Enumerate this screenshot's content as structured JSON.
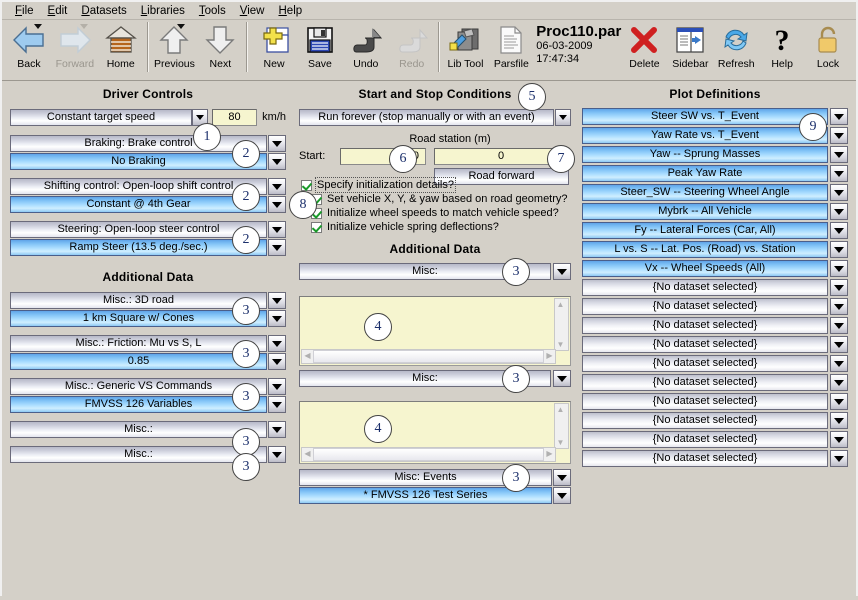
{
  "menu": {
    "items": [
      "File",
      "Edit",
      "Datasets",
      "Libraries",
      "Tools",
      "View",
      "Help"
    ]
  },
  "toolbar": {
    "buttons": [
      {
        "label": "Back",
        "icon": "back-arrow-icon",
        "enabled": true,
        "dropdown": true
      },
      {
        "label": "Forward",
        "icon": "forward-arrow-icon",
        "enabled": false,
        "dropdown": true
      },
      {
        "label": "Home",
        "icon": "home-icon",
        "enabled": true,
        "dropdown": false
      },
      {
        "label": "Previous",
        "icon": "up-arrow-icon",
        "enabled": true,
        "dropdown": true
      },
      {
        "label": "Next",
        "icon": "down-arrow-icon",
        "enabled": true,
        "dropdown": false
      },
      {
        "label": "New",
        "icon": "new-document-icon",
        "enabled": true,
        "dropdown": false
      },
      {
        "label": "Save",
        "icon": "floppy-disk-icon",
        "enabled": true,
        "dropdown": false
      },
      {
        "label": "Undo",
        "icon": "undo-arrow-icon",
        "enabled": true,
        "dropdown": false
      },
      {
        "label": "Redo",
        "icon": "redo-arrow-icon",
        "enabled": false,
        "dropdown": false
      },
      {
        "label": "Lib Tool",
        "icon": "library-tool-icon",
        "enabled": true,
        "dropdown": false
      },
      {
        "label": "Parsfile",
        "icon": "parsfile-icon",
        "enabled": true,
        "dropdown": false
      }
    ],
    "file_name": "Proc110.par",
    "file_date": "06-03-2009 17:47:34",
    "right_buttons": [
      {
        "label": "Delete",
        "icon": "red-x-icon",
        "enabled": true
      },
      {
        "label": "Sidebar",
        "icon": "sidebar-icon",
        "enabled": true
      },
      {
        "label": "Refresh",
        "icon": "refresh-icon",
        "enabled": true
      },
      {
        "label": "Help",
        "icon": "question-mark-icon",
        "enabled": true
      },
      {
        "label": "Lock",
        "icon": "padlock-icon",
        "enabled": true
      }
    ]
  },
  "left_column": {
    "title": "Driver Controls",
    "speed_control": {
      "label": "Constant target speed",
      "value": "80",
      "unit": "km/h",
      "callout": "1"
    },
    "controls": [
      {
        "top": "Braking: Brake control",
        "bottom": "No Braking",
        "callout": "2"
      },
      {
        "top": "Shifting control: Open-loop shift control",
        "bottom": "Constant @ 4th Gear",
        "callout": "2"
      },
      {
        "top": "Steering: Open-loop steer control",
        "bottom": "Ramp Steer (13.5 deg./sec.)",
        "callout": "2"
      }
    ],
    "additional_title": "Additional Data",
    "additional": [
      {
        "top": "Misc.: 3D road",
        "bottom": "1 km Square w/ Cones",
        "callout": "3"
      },
      {
        "top": "Misc.: Friction: Mu vs S, L",
        "bottom": "0.85",
        "callout": "3"
      },
      {
        "top": "Misc.: Generic VS Commands",
        "bottom": "FMVSS 126 Variables",
        "callout": "3"
      },
      {
        "top": "Misc.:",
        "bottom": null,
        "callout": "3"
      },
      {
        "top": "Misc.:",
        "bottom": null,
        "callout": "3"
      }
    ]
  },
  "middle_column": {
    "title": "Start and Stop Conditions",
    "title_callout": "5",
    "run_mode": "Run forever (stop manually or with an event)",
    "road_station_label": "Road station (m)",
    "start_label": "Start:",
    "start_value": "0",
    "start_callout": "6",
    "station_value": "0",
    "direction": "Road forward",
    "direction_callout": "7",
    "checkboxes": [
      {
        "label": "Specify initialization details?",
        "checked": true,
        "focused": true,
        "indent": 0
      },
      {
        "label": "Set vehicle X, Y, & yaw based on road geometry?",
        "checked": true,
        "focused": false,
        "indent": 1
      },
      {
        "label": "Initialize wheel speeds to match vehicle speed?",
        "checked": true,
        "focused": false,
        "indent": 1
      },
      {
        "label": "Initialize vehicle spring deflections?",
        "checked": true,
        "focused": false,
        "indent": 1
      }
    ],
    "checkbox_callout": "8",
    "additional_title": "Additional Data",
    "misc_1": {
      "label": "Misc:",
      "callout": "3"
    },
    "notes_1_callout": "4",
    "misc_2": {
      "label": "Misc:",
      "callout": "3"
    },
    "notes_2_callout": "4",
    "events": {
      "top": "Misc: Events",
      "bottom": "* FMVSS 126 Test Series",
      "callout": "3"
    }
  },
  "right_column": {
    "title": "Plot Definitions",
    "callout": "9",
    "items": [
      {
        "label": "Steer SW vs. T_Event",
        "selected": true
      },
      {
        "label": "Yaw Rate vs. T_Event",
        "selected": true
      },
      {
        "label": "Yaw -- Sprung Masses",
        "selected": true
      },
      {
        "label": "Peak Yaw Rate",
        "selected": true
      },
      {
        "label": "Steer_SW -- Steering Wheel Angle",
        "selected": true
      },
      {
        "label": "Mybrk -- All Vehicle",
        "selected": true
      },
      {
        "label": "Fy -- Lateral Forces (Car, All)",
        "selected": true
      },
      {
        "label": "L vs. S -- Lat. Pos. (Road) vs. Station",
        "selected": true
      },
      {
        "label": "Vx -- Wheel Speeds (All)",
        "selected": true
      },
      {
        "label": "{No dataset selected}",
        "selected": false
      },
      {
        "label": "{No dataset selected}",
        "selected": false
      },
      {
        "label": "{No dataset selected}",
        "selected": false
      },
      {
        "label": "{No dataset selected}",
        "selected": false
      },
      {
        "label": "{No dataset selected}",
        "selected": false
      },
      {
        "label": "{No dataset selected}",
        "selected": false
      },
      {
        "label": "{No dataset selected}",
        "selected": false
      },
      {
        "label": "{No dataset selected}",
        "selected": false
      },
      {
        "label": "{No dataset selected}",
        "selected": false
      },
      {
        "label": "{No dataset selected}",
        "selected": false
      }
    ]
  },
  "colors": {
    "window_bg": "#d4d0c8",
    "selected_blue": "#8cc8f3",
    "field_yellow": "#f6f5cf",
    "callout_text": "#1b2f6b",
    "delete_red": "#d32020"
  }
}
